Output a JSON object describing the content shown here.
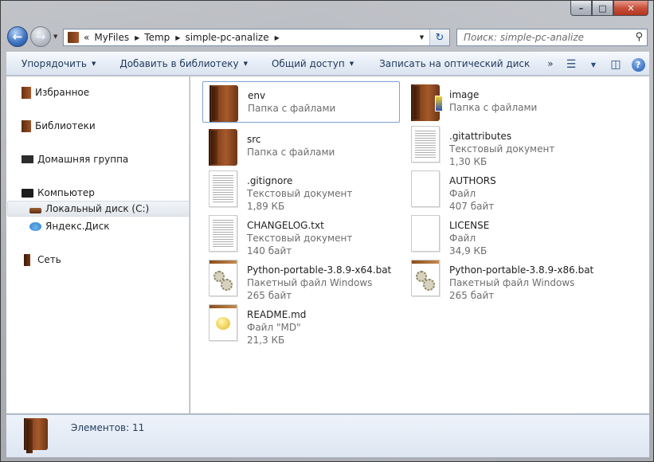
{
  "window": {
    "caption_buttons": [
      "–",
      "□",
      "✕"
    ]
  },
  "address": {
    "overflow": "«",
    "parts": [
      "MyFiles",
      "Temp",
      "simple-pc-analize"
    ]
  },
  "search": {
    "placeholder": "Поиск: simple-pc-analize"
  },
  "toolbar": {
    "organize": "Упорядочить",
    "add_to_library": "Добавить в библиотеку",
    "share": "Общий доступ",
    "burn": "Записать на оптический диск",
    "more": "»"
  },
  "nav": {
    "items": [
      {
        "label": "Избранное",
        "icon": "favorites-icon"
      },
      {
        "label": "Библиотеки",
        "icon": "libraries-icon"
      },
      {
        "label": "Домашняя группа",
        "icon": "homegroup-icon"
      },
      {
        "label": "Компьютер",
        "icon": "computer-icon"
      },
      {
        "label": "Локальный диск (C:)",
        "icon": "drive-icon"
      },
      {
        "label": "Яндекс.Диск",
        "icon": "cloud-icon"
      },
      {
        "label": "Сеть",
        "icon": "network-icon"
      }
    ]
  },
  "files": [
    {
      "name": "env",
      "type": "Папка с файлами",
      "size": ""
    },
    {
      "name": "image",
      "type": "Папка с файлами",
      "size": ""
    },
    {
      "name": "src",
      "type": "Папка с файлами",
      "size": ""
    },
    {
      "name": ".gitattributes",
      "type": "Текстовый документ",
      "size": "1,30 КБ"
    },
    {
      "name": ".gitignore",
      "type": "Текстовый документ",
      "size": "1,89 КБ"
    },
    {
      "name": "AUTHORS",
      "type": "Файл",
      "size": "407 байт"
    },
    {
      "name": "CHANGELOG.txt",
      "type": "Текстовый документ",
      "size": "140 байт"
    },
    {
      "name": "LICENSE",
      "type": "Файл",
      "size": "34,9 КБ"
    },
    {
      "name": "Python-portable-3.8.9-x64.bat",
      "type": "Пакетный файл Windows",
      "size": "265 байт"
    },
    {
      "name": "Python-portable-3.8.9-x86.bat",
      "type": "Пакетный файл Windows",
      "size": "265 байт"
    },
    {
      "name": "README.md",
      "type": "Файл \"MD\"",
      "size": "21,3 КБ"
    }
  ],
  "status": {
    "count_text": "Элементов: 11"
  }
}
